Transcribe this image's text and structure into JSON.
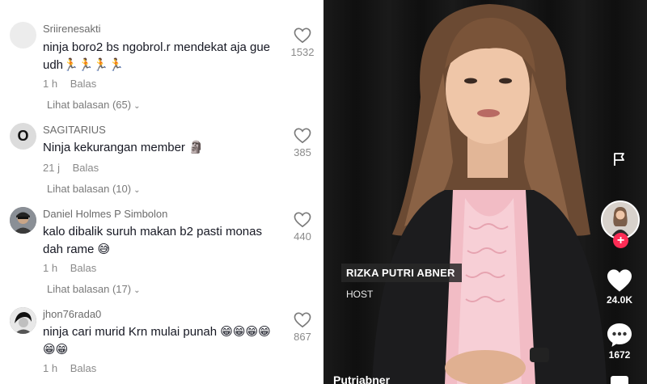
{
  "comments": [
    {
      "username": "Sriirenesakti",
      "text": "ninja boro2 bs ngobrol.r mendekat aja gue udh🏃🏃🏃🏃",
      "time": "1 h",
      "reply_label": "Balas",
      "view_replies": "Lihat balasan (65)",
      "likes": "1532",
      "avatar": "blank"
    },
    {
      "username": "SAGITARIUS",
      "text": "Ninja kekurangan member 🗿",
      "time": "21 j",
      "reply_label": "Balas",
      "view_replies": "Lihat balasan (10)",
      "likes": "385",
      "avatar": "O"
    },
    {
      "username": "Daniel Holmes P Simbolon",
      "text": "kalo dibalik suruh makan b2 pasti monas dah rame 😅",
      "time": "1 h",
      "reply_label": "Balas",
      "view_replies": "Lihat balasan (17)",
      "likes": "440",
      "avatar": "photo"
    },
    {
      "username": "jhon76rada0",
      "text": "ninja cari murid Krn mulai punah 😁😁😁😁😁😁",
      "time": "1 h",
      "reply_label": "Balas",
      "likes": "867",
      "avatar": "photo"
    }
  ],
  "video": {
    "lower_third_name": "RIZKA PUTRI ABNER",
    "lower_third_role": "HOST",
    "author_handle": "Putriabner",
    "like_count": "24.0K",
    "comment_count": "1672"
  },
  "icons": {
    "comment_like": "heart-outline-icon",
    "flag": "flag-icon",
    "video_like": "heart-filled-icon",
    "video_comment": "comment-bubble-icon",
    "follow": "plus-icon"
  },
  "colors": {
    "follow_accent": "#fe2c55",
    "text_primary": "#161823",
    "text_muted": "#8a8a8a"
  }
}
